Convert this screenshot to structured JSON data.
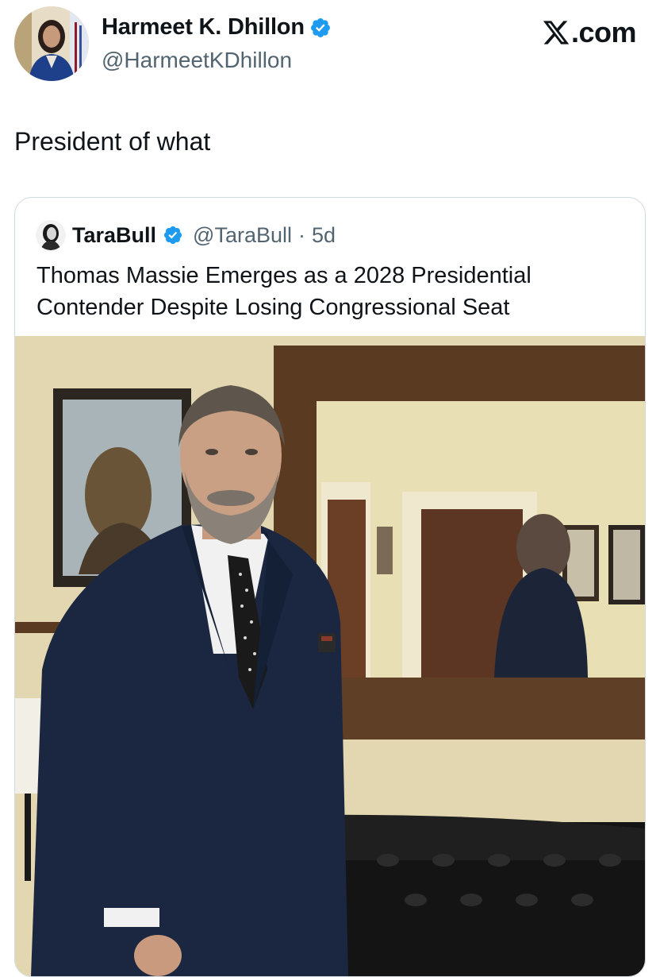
{
  "author": {
    "name": "Harmeet K. Dhillon",
    "handle": "@HarmeetKDhillon",
    "avatar_icon": "profile-photo",
    "verified_icon": "verified-badge-icon"
  },
  "brand": {
    "label": ".com",
    "logo_icon": "x-logo-icon"
  },
  "post": {
    "text": "President of what"
  },
  "quoted_post": {
    "author_name": "TaraBull",
    "handle": "@TaraBull",
    "separator": "·",
    "time": "5d",
    "text": "Thomas Massie Emerges as a 2028 Presidential Contender Despite Losing Congressional Seat",
    "image_icon": "man-in-suit-office-photo"
  },
  "colors": {
    "verified": "#1d9bf0",
    "text": "#0f1419",
    "secondary": "#536471",
    "border": "#cfd9de"
  }
}
